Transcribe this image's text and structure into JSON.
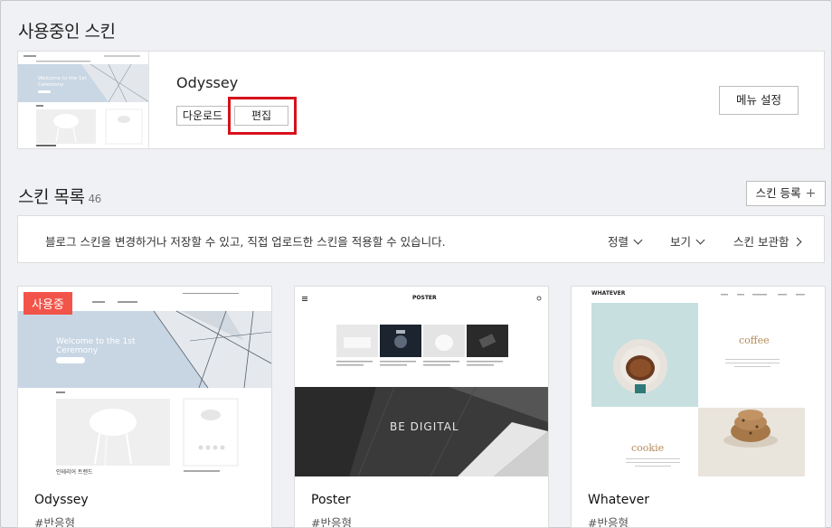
{
  "current": {
    "heading": "사용중인 스킨",
    "skin_name": "Odyssey",
    "download_label": "다운로드",
    "edit_label": "편집",
    "menu_settings_label": "메뉴 설정",
    "thumb_welcome": "Welcome to the 1st Ceremony"
  },
  "list": {
    "heading": "스킨 목록",
    "count": "46",
    "register_label": "스킨 등록",
    "info_text": "블로그 스킨을 변경하거나 저장할 수 있고, 직접 업로드한 스킨을 적용할 수 있습니다.",
    "sort_label": "정렬",
    "view_label": "보기",
    "storage_label": "스킨 보관함"
  },
  "cards": [
    {
      "name": "Odyssey",
      "tag": "#반응형",
      "badge": "사용중",
      "welcome_line1": "Welcome to the 1st",
      "welcome_line2": "Ceremony",
      "sub_caption": "인테리어 트렌드"
    },
    {
      "name": "Poster",
      "tag": "#반응형",
      "site_title": "POSTER",
      "hero_text": "BE DIGITAL"
    },
    {
      "name": "Whatever",
      "tag": "#반응형",
      "site_title": "WHATEVER",
      "coffee_label": "coffee",
      "cookie_label": "cookie"
    }
  ],
  "colors": {
    "accent_red": "#d6121c",
    "badge": "#f2544a"
  }
}
